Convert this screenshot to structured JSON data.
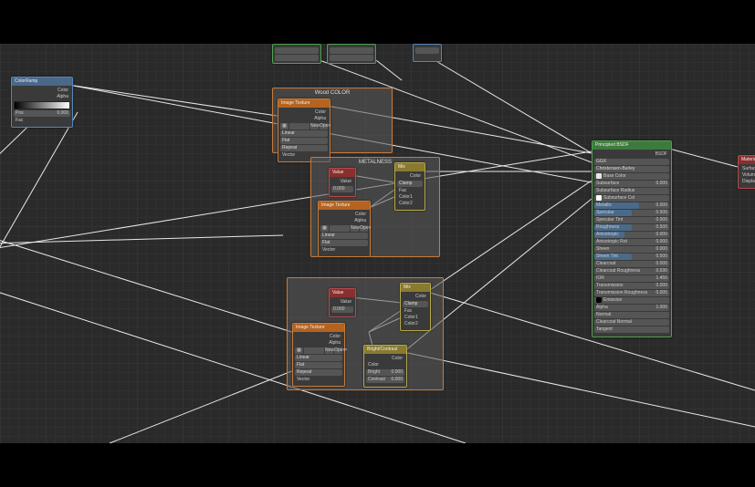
{
  "frames": {
    "top": {
      "label": "Wood COLOR"
    },
    "mid": {
      "label": "METALNESS"
    },
    "bot": {
      "label": ""
    }
  },
  "nodes": {
    "colorramp": {
      "title": "ColorRamp",
      "out_color": "Color",
      "out_alpha": "Alpha",
      "pos_label": "Pos",
      "pos_val": "0.000",
      "in_fac": "Fac"
    },
    "partial_top1": {
      "title": ""
    },
    "partial_top2": {
      "title": ""
    },
    "imageTex": {
      "title": "Image Texture",
      "out_color": "Color",
      "out_alpha": "Alpha",
      "img_name": "",
      "btn_new": "New",
      "btn_open": "Open",
      "opt1": "Linear",
      "opt2": "Flat",
      "opt3": "Repeat",
      "in_vector": "Vector"
    },
    "value1": {
      "title": "Value",
      "out": "Value",
      "val": "0.000"
    },
    "value2": {
      "title": "Value",
      "out": "Value",
      "val": "0.000"
    },
    "mix1": {
      "title": "Mix",
      "out": "Color",
      "clamp": "Clamp",
      "in_fac": "Fac",
      "in_c1": "Color1",
      "in_c2": "Color2"
    },
    "mix2": {
      "title": "Mix",
      "out": "Color",
      "clamp": "Clamp",
      "in_fac": "Fac",
      "in_c1": "Color1",
      "in_c2": "Color2"
    },
    "brightcontrast": {
      "title": "Bright/Contrast",
      "out": "Color",
      "in_color": "Color",
      "bright": "Bright",
      "bright_v": "0.000",
      "contrast": "Contrast",
      "contrast_v": "0.000"
    },
    "principled": {
      "title": "Principled BSDF",
      "out": "BSDF",
      "dist": "GGX",
      "sss": "Christensen-Burley",
      "rows": [
        {
          "l": "Base Color",
          "v": "",
          "c": "#e8e8e8"
        },
        {
          "l": "Subsurface",
          "v": "0.000"
        },
        {
          "l": "Subsurface Radius",
          "v": ""
        },
        {
          "l": "Subsurface Col",
          "v": "",
          "c": "#ffffff"
        },
        {
          "l": "Metallic",
          "v": "0.000",
          "fill": 60
        },
        {
          "l": "Specular",
          "v": "0.500",
          "fill": 50
        },
        {
          "l": "Specular Tint",
          "v": "0.000"
        },
        {
          "l": "Roughness",
          "v": "0.500",
          "fill": 50
        },
        {
          "l": "Anisotropic",
          "v": "0.000",
          "fill": 40
        },
        {
          "l": "Anisotropic Rot",
          "v": "0.000"
        },
        {
          "l": "Sheen",
          "v": "0.000"
        },
        {
          "l": "Sheen Tint",
          "v": "0.500",
          "fill": 50
        },
        {
          "l": "Clearcoat",
          "v": "0.000"
        },
        {
          "l": "Clearcoat Roughness",
          "v": "0.030"
        },
        {
          "l": "IOR",
          "v": "1.450"
        },
        {
          "l": "Transmission",
          "v": "0.000"
        },
        {
          "l": "Transmission Roughness",
          "v": "0.000"
        },
        {
          "l": "Emission",
          "v": "",
          "c": "#000000"
        },
        {
          "l": "Alpha",
          "v": "1.000"
        },
        {
          "l": "Normal",
          "v": ""
        },
        {
          "l": "Clearcoat Normal",
          "v": ""
        },
        {
          "l": "Tangent",
          "v": ""
        }
      ]
    },
    "matout": {
      "title": "Material Output",
      "rows": [
        "Surface",
        "Volume",
        "Displacement"
      ]
    }
  }
}
